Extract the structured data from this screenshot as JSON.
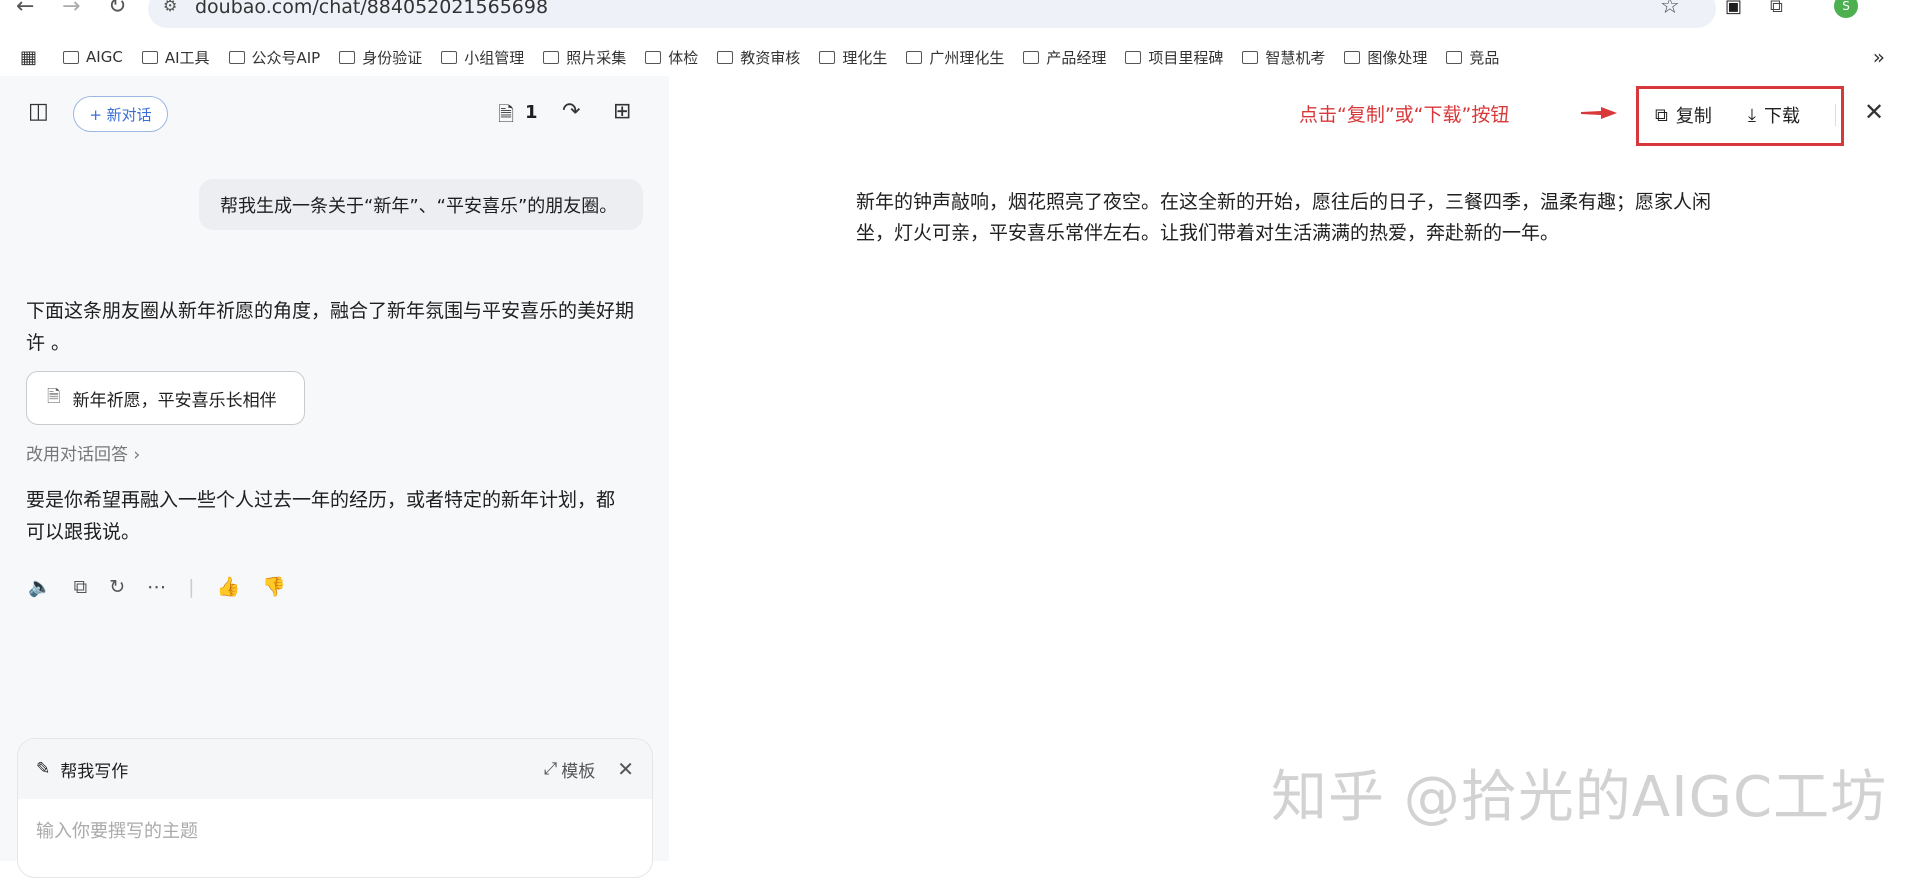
{
  "browser": {
    "url": "doubao.com/chat/884052021565698",
    "avatar_letter": "S",
    "bookmarks": [
      "AIGC",
      "AI工具",
      "公众号AIP",
      "身份验证",
      "小组管理",
      "照片采集",
      "体检",
      "教资审核",
      "理化生",
      "广州理化生",
      "产品经理",
      "项目里程碑",
      "智慧机考",
      "图像处理",
      "竞品"
    ],
    "more": "»"
  },
  "left": {
    "new_chat": "+ 新对话",
    "doc_count": "1",
    "user_message": "帮我生成一条关于“新年”、“平安喜乐”的朋友圈。",
    "reply_intro": "下面这条朋友圈从新年祈愿的角度，融合了新年氛围与平安喜乐的美好期许 。",
    "doc_card": "新年祈愿，平安喜乐长相伴",
    "switch_label": "改用对话回答 ›",
    "reply_followup": "要是你希望再融入一些个人过去一年的经历，或者特定的新年计划，都可以跟我说。",
    "write_title": "帮我写作",
    "template_label": "模板",
    "input_placeholder": "输入你要撰写的主题"
  },
  "right": {
    "annotation": "点击“复制”或“下载”按钮",
    "copy": "复制",
    "download": "下载",
    "content": "新年的钟声敲响，烟花照亮了夜空。在这全新的开始，愿往后的日子，三餐四季，温柔有趣；愿家人闲坐，灯火可亲，平安喜乐常伴左右。让我们带着对生活满满的热爱，奔赴新的一年。"
  },
  "watermark": "知乎 @拾光的AIGC工坊",
  "colors": {
    "annotation": "#d8383a",
    "accent": "#3a6fd8"
  }
}
